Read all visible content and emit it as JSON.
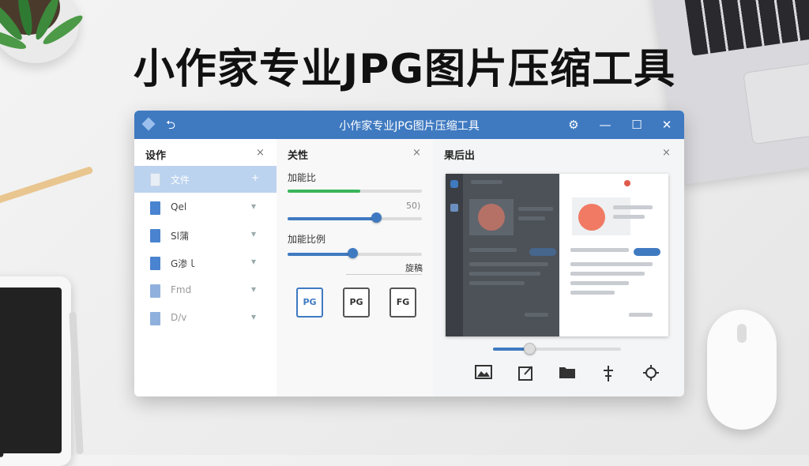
{
  "headline": "小作家专业JPG图片压缩工具",
  "window": {
    "title": "小作家专业JPG图片压缩工具",
    "buttons": {
      "settings": "⚙",
      "minimize": "—",
      "maximize": "☐",
      "close": "✕",
      "undo": "⮌"
    }
  },
  "files_pane": {
    "title": "设作",
    "close": "×",
    "items": [
      {
        "label": "文件",
        "control": "+"
      },
      {
        "label": "Qel",
        "control": "▾"
      },
      {
        "label": "Sl蒲",
        "control": "▾"
      },
      {
        "label": "G渗ｌ",
        "control": "▾"
      },
      {
        "label": "Fmd",
        "control": "▾"
      },
      {
        "label": "D/v",
        "control": "▾"
      }
    ]
  },
  "settings_pane": {
    "title": "关性",
    "close": "×",
    "label_1": "加能比",
    "green_progress": 0.54,
    "value_label": "50)",
    "slider_1": 0.66,
    "label_2": "加能比例",
    "slider_2": 0.48,
    "link": "旋稿",
    "formats": [
      "PG",
      "PG",
      "FG"
    ]
  },
  "preview_pane": {
    "title": "果后出",
    "close": "×",
    "zoom_slider": 0.28,
    "tools": [
      "image-icon",
      "edit-export-icon",
      "folder-icon",
      "align-icon",
      "crop-target-icon"
    ]
  },
  "colors": {
    "accent": "#3f7ac1",
    "success": "#3bb55a",
    "active_row": "#bcd3ef",
    "preview_accent": "#f07a63"
  }
}
